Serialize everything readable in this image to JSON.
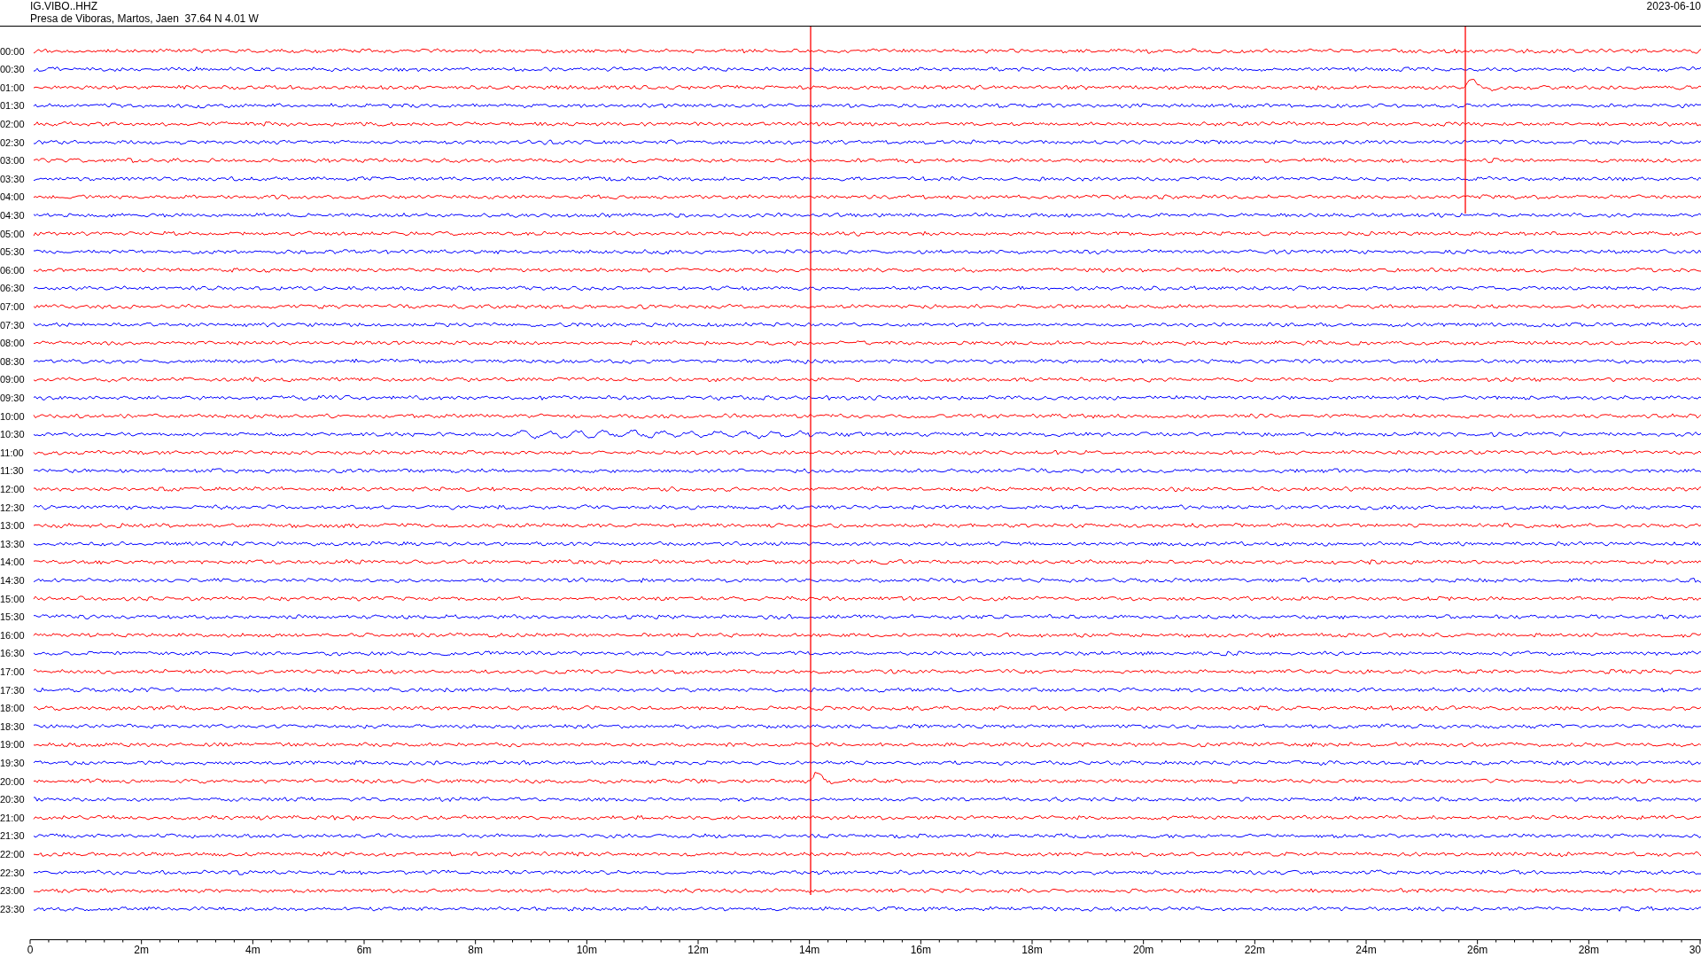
{
  "header": {
    "station": "IG.VIBO..HHZ",
    "location": "Presa de Viboras, Martos, Jaen  37.64 N 4.01 W",
    "date": "2023-06-10"
  },
  "rows": [
    {
      "time": "00:00",
      "color": "#ff0000"
    },
    {
      "time": "00:30",
      "color": "#0000ff"
    },
    {
      "time": "01:00",
      "color": "#ff0000"
    },
    {
      "time": "01:30",
      "color": "#0000ff"
    },
    {
      "time": "02:00",
      "color": "#ff0000"
    },
    {
      "time": "02:30",
      "color": "#0000ff"
    },
    {
      "time": "03:00",
      "color": "#ff0000"
    },
    {
      "time": "03:30",
      "color": "#0000ff"
    },
    {
      "time": "04:00",
      "color": "#ff0000"
    },
    {
      "time": "04:30",
      "color": "#0000ff"
    },
    {
      "time": "05:00",
      "color": "#ff0000"
    },
    {
      "time": "05:30",
      "color": "#0000ff"
    },
    {
      "time": "06:00",
      "color": "#ff0000"
    },
    {
      "time": "06:30",
      "color": "#0000ff"
    },
    {
      "time": "07:00",
      "color": "#ff0000"
    },
    {
      "time": "07:30",
      "color": "#0000ff"
    },
    {
      "time": "08:00",
      "color": "#ff0000"
    },
    {
      "time": "08:30",
      "color": "#0000ff"
    },
    {
      "time": "09:00",
      "color": "#ff0000"
    },
    {
      "time": "09:30",
      "color": "#0000ff"
    },
    {
      "time": "10:00",
      "color": "#ff0000"
    },
    {
      "time": "10:30",
      "color": "#0000ff"
    },
    {
      "time": "11:00",
      "color": "#ff0000"
    },
    {
      "time": "11:30",
      "color": "#0000ff"
    },
    {
      "time": "12:00",
      "color": "#ff0000"
    },
    {
      "time": "12:30",
      "color": "#0000ff"
    },
    {
      "time": "13:00",
      "color": "#ff0000"
    },
    {
      "time": "13:30",
      "color": "#0000ff"
    },
    {
      "time": "14:00",
      "color": "#ff0000"
    },
    {
      "time": "14:30",
      "color": "#0000ff"
    },
    {
      "time": "15:00",
      "color": "#ff0000"
    },
    {
      "time": "15:30",
      "color": "#0000ff"
    },
    {
      "time": "16:00",
      "color": "#ff0000"
    },
    {
      "time": "16:30",
      "color": "#0000ff"
    },
    {
      "time": "17:00",
      "color": "#ff0000"
    },
    {
      "time": "17:30",
      "color": "#0000ff"
    },
    {
      "time": "18:00",
      "color": "#ff0000"
    },
    {
      "time": "18:30",
      "color": "#0000ff"
    },
    {
      "time": "19:00",
      "color": "#ff0000"
    },
    {
      "time": "19:30",
      "color": "#0000ff"
    },
    {
      "time": "20:00",
      "color": "#ff0000"
    },
    {
      "time": "20:30",
      "color": "#0000ff"
    },
    {
      "time": "21:00",
      "color": "#ff0000"
    },
    {
      "time": "21:30",
      "color": "#0000ff"
    },
    {
      "time": "22:00",
      "color": "#ff0000"
    },
    {
      "time": "22:30",
      "color": "#0000ff"
    },
    {
      "time": "23:00",
      "color": "#ff0000"
    },
    {
      "time": "23:30",
      "color": "#0000ff"
    }
  ],
  "axis": {
    "labels": [
      "0",
      "2m",
      "4m",
      "6m",
      "8m",
      "10m",
      "12m",
      "14m",
      "16m",
      "18m",
      "20m",
      "22m",
      "24m",
      "26m",
      "28m",
      "30"
    ]
  }
}
